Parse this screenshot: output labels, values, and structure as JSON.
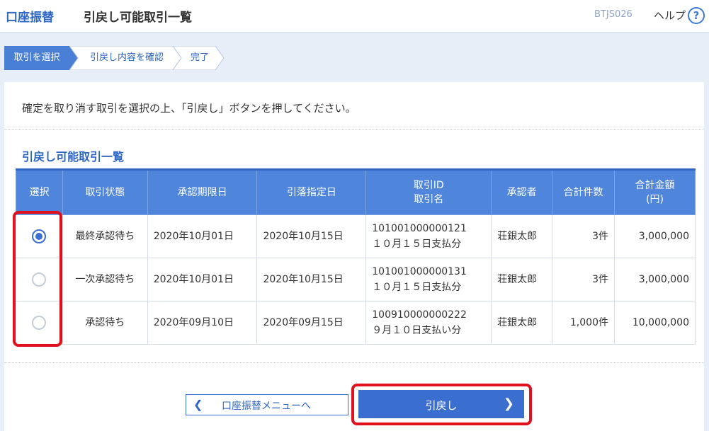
{
  "header": {
    "brand": "口座振替",
    "title": "引戻し可能取引一覧",
    "screen_id": "BTJS026",
    "help_label": "ヘルプ",
    "help_icon": "?"
  },
  "steps": [
    {
      "label": "取引を選択",
      "active": true
    },
    {
      "label": "引戻し内容を確認",
      "active": false
    },
    {
      "label": "完了",
      "active": false
    }
  ],
  "instruction": "確定を取り消す取引を選択の上、「引戻し」ボタンを押してください。",
  "section_title": "引戻し可能取引一覧",
  "table": {
    "headers": {
      "select": "選択",
      "status": "取引状態",
      "approval_deadline": "承認期限日",
      "debit_date": "引落指定日",
      "tx_id_line1": "取引ID",
      "tx_id_line2": "取引名",
      "approver": "承認者",
      "total_count": "合計件数",
      "total_amount_line1": "合計金額",
      "total_amount_line2": "(円)"
    },
    "rows": [
      {
        "selected": true,
        "status": "最終承認待ち",
        "approval_deadline": "2020年10月01日",
        "debit_date": "2020年10月15日",
        "tx_id": "101001000000121",
        "tx_name": "１０月１５日支払分",
        "approver": "荘銀太郎",
        "count": "3件",
        "amount": "3,000,000"
      },
      {
        "selected": false,
        "status": "一次承認待ち",
        "approval_deadline": "2020年10月01日",
        "debit_date": "2020年10月15日",
        "tx_id": "101001000000131",
        "tx_name": "１０月１５日支払分",
        "approver": "荘銀太郎",
        "count": "3件",
        "amount": "3,000,000"
      },
      {
        "selected": false,
        "status": "承認待ち",
        "approval_deadline": "2020年09月10日",
        "debit_date": "2020年09月15日",
        "tx_id": "100910000000222",
        "tx_name": "９月１０日支払い分",
        "approver": "荘銀太郎",
        "count": "1,000件",
        "amount": "10,000,000"
      }
    ]
  },
  "buttons": {
    "back_label": "口座振替メニューへ",
    "next_label": "引戻し"
  },
  "colors": {
    "accent": "#3a6fd0",
    "header_blue": "#4f86dc",
    "highlight": "#e0101c"
  }
}
